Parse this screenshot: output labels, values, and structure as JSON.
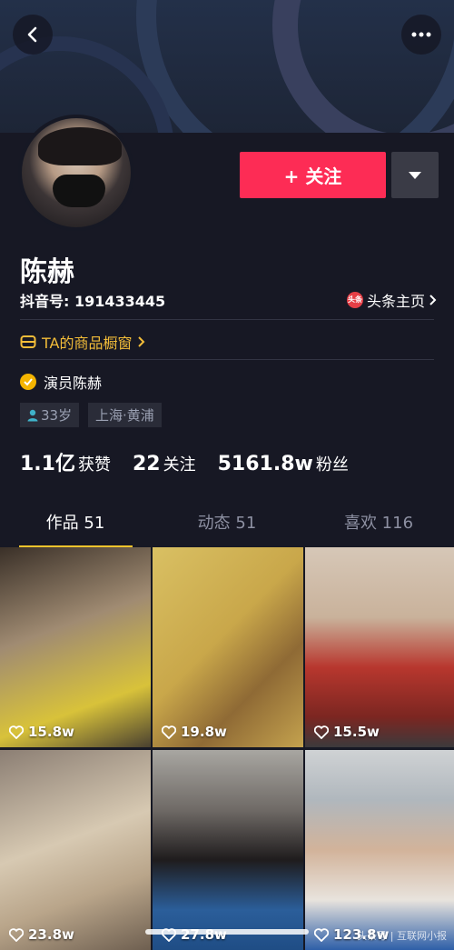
{
  "header": {
    "back_icon": "back-icon",
    "more_icon": "more-icon"
  },
  "profile": {
    "name": "陈赫",
    "douyin_id": "抖音号: 191433445",
    "toutiao_label": "头条主页",
    "toutiao_icon_text": "头条",
    "follow_label": "+ 关注",
    "shop_label": "TA的商品橱窗",
    "verify_label": "演员陈赫",
    "tags": [
      "33岁",
      "上海·黄浦"
    ]
  },
  "stats": {
    "likes_num": "1.1亿",
    "likes_label": "获赞",
    "following_num": "22",
    "following_label": "关注",
    "followers_num": "5161.8w",
    "followers_label": "粉丝"
  },
  "tabs": [
    {
      "label": "作品 51",
      "active": true
    },
    {
      "label": "动态 51",
      "active": false
    },
    {
      "label": "喜欢 116",
      "active": false
    }
  ],
  "videos": [
    {
      "likes": "15.8w"
    },
    {
      "likes": "19.8w"
    },
    {
      "likes": "15.5w"
    },
    {
      "likes": "23.8w"
    },
    {
      "likes": "27.8w"
    },
    {
      "likes": "123.8w"
    }
  ],
  "watermark": "头条号 | 互联网小报",
  "colors": {
    "accent": "#fd2c55",
    "shop": "#f3bd39",
    "tab_underline": "#f5c42c",
    "background": "#161824"
  }
}
